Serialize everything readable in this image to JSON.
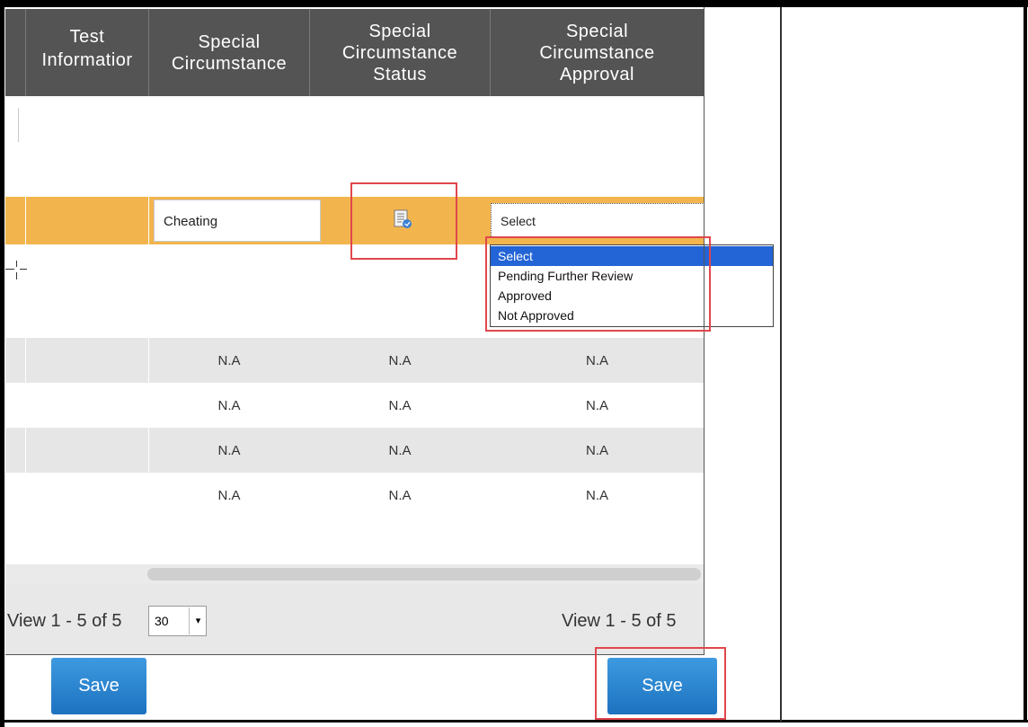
{
  "columns": [
    {
      "label": "Test\nInformatior"
    },
    {
      "label": "Special\nCircumstance"
    },
    {
      "label": "Special\nCircumstance\nStatus"
    },
    {
      "label": "Special\nCircumstance\nApproval"
    }
  ],
  "active_row": {
    "special_circumstance": "Cheating",
    "status_icon": "document-edit-icon",
    "approval_select": "Select"
  },
  "approval_options": [
    "Select",
    "Pending Further Review",
    "Approved",
    "Not Approved"
  ],
  "approval_selected_index": 0,
  "rows": [
    [
      "N.A",
      "N.A",
      "N.A"
    ],
    [
      "N.A",
      "N.A",
      "N.A"
    ],
    [
      "N.A",
      "N.A",
      "N.A"
    ],
    [
      "N.A",
      "N.A",
      "N.A"
    ]
  ],
  "pager": {
    "left_text": "View 1 - 5 of 5",
    "page_size": "30",
    "right_text": "View 1 - 5 of 5"
  },
  "buttons": {
    "save_left": "Save",
    "save_right": "Save"
  },
  "colors": {
    "header_bg": "#545454",
    "highlight_row": "#f2b54d",
    "annotation_red": "#e0474c",
    "button_blue": "#2b86d1"
  }
}
